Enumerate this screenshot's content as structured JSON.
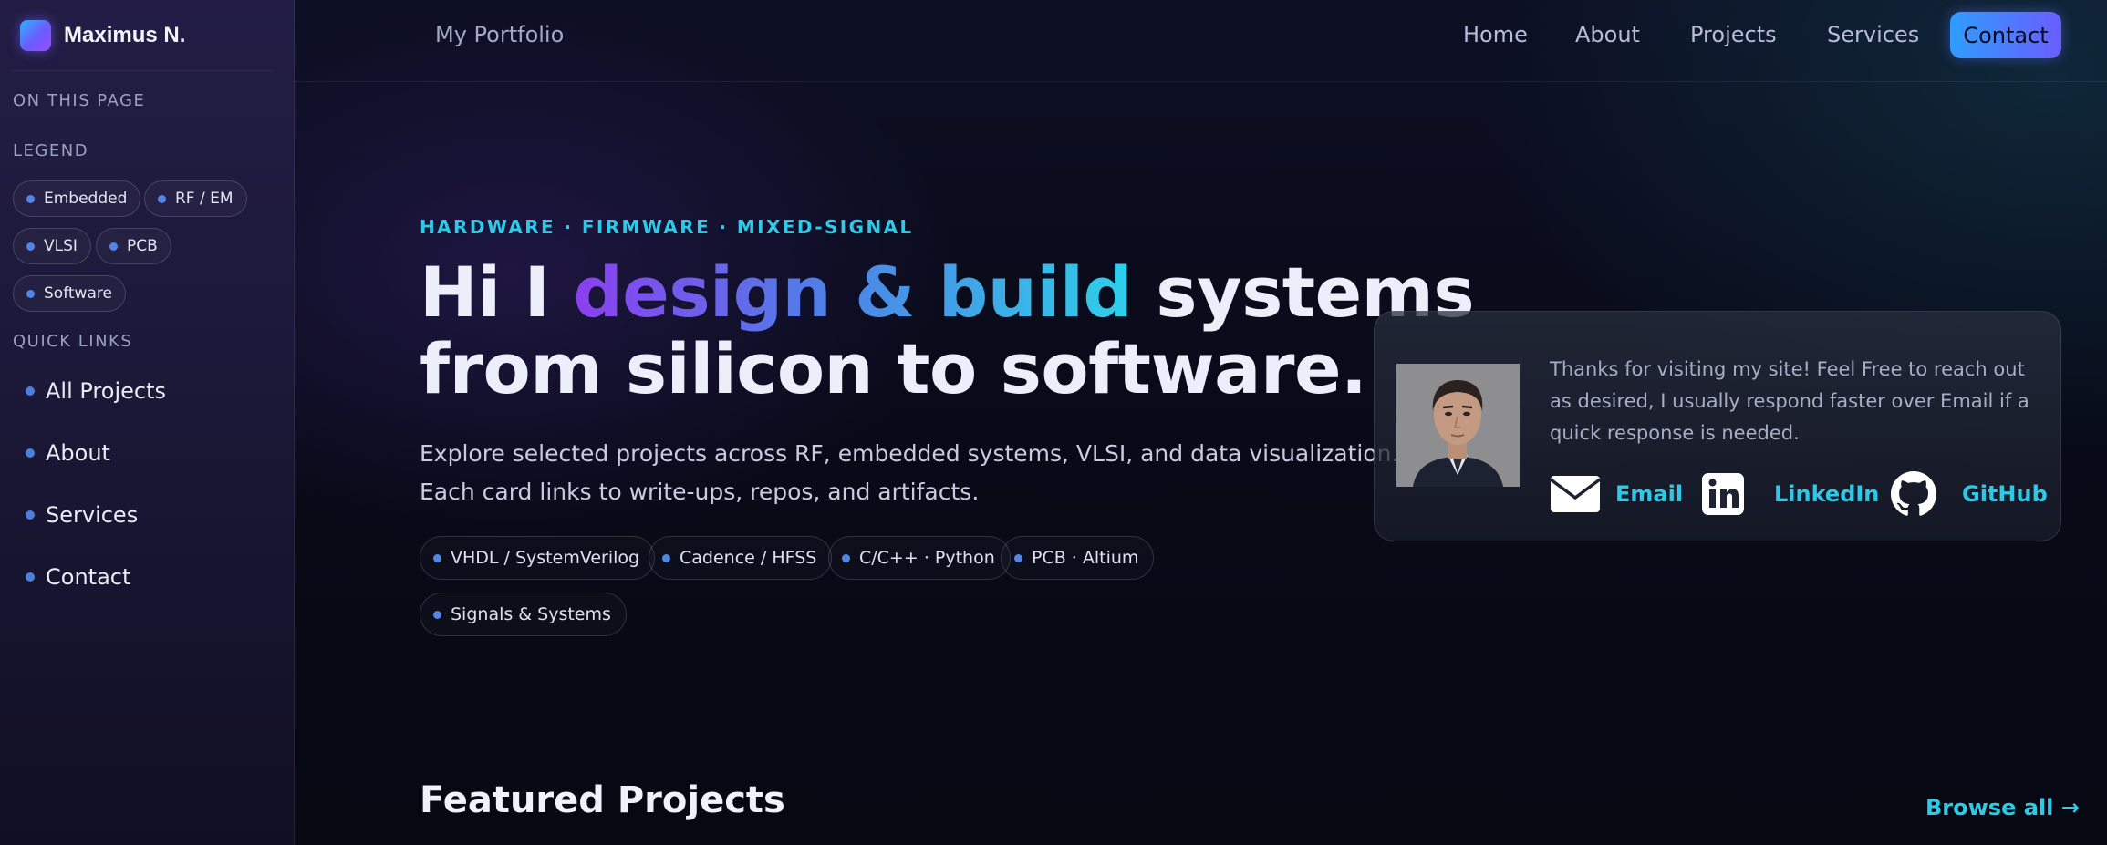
{
  "brand": {
    "name": "Maximus N."
  },
  "sidebar": {
    "on_this_page": "ON THIS PAGE",
    "legend_heading": "LEGEND",
    "legend": [
      "Embedded",
      "RF / EM",
      "VLSI",
      "PCB",
      "Software"
    ],
    "quick_links_heading": "QUICK LINKS",
    "quick_links": [
      "All Projects",
      "About",
      "Services",
      "Contact"
    ]
  },
  "topbar": {
    "title": "My Portfolio",
    "nav": [
      "Home",
      "About",
      "Projects",
      "Services"
    ],
    "contact": "Contact"
  },
  "hero": {
    "kicker": "HARDWARE · FIRMWARE · MIXED-SIGNAL",
    "line1_a": "Hi I",
    "line1_highlight": "design & build",
    "line1_b": "systems",
    "line2": "from silicon to software.",
    "sub1": "Explore selected projects across RF, embedded systems, VLSI, and data visualization.",
    "sub2": "Each card links to write-ups, repos, and artifacts.",
    "skills": [
      "VHDL / SystemVerilog",
      "Cadence / HFSS",
      "C/C++ · Python",
      "PCB · Altium",
      "Signals & Systems"
    ]
  },
  "card": {
    "text": "Thanks for visiting my site! Feel Free to reach out as desired, I usually respond faster over Email if a quick response is needed.",
    "email": "Email",
    "linkedin": "LinkedIn",
    "github": "GitHub"
  },
  "featured": {
    "title": "Featured Projects",
    "browse": "Browse all →"
  },
  "colors": {
    "accent_cyan": "#2ec9e6",
    "accent_purple": "#8b3ff0",
    "dot_blue": "#4f86e8"
  }
}
